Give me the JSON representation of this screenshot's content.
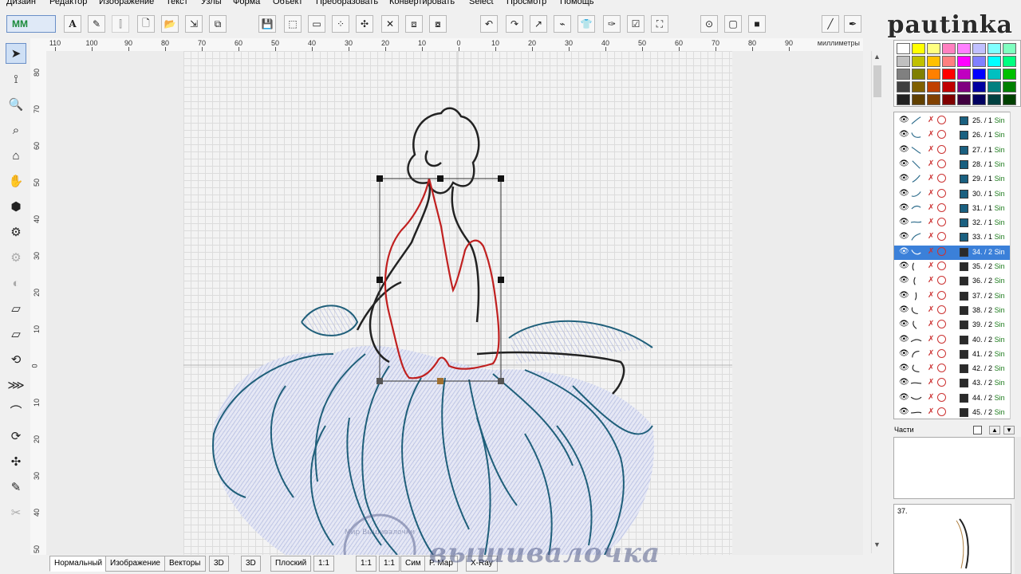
{
  "menu": [
    {
      "label": "Дизайн"
    },
    {
      "label": "Редактор"
    },
    {
      "label": "Изображение"
    },
    {
      "label": "Текст"
    },
    {
      "label": "Узлы"
    },
    {
      "label": "Форма"
    },
    {
      "label": "Объект"
    },
    {
      "label": "Преобразовать"
    },
    {
      "label": "Конвертировать"
    },
    {
      "label": "Select"
    },
    {
      "label": "Просмотр"
    },
    {
      "label": "Помощь"
    }
  ],
  "toolbar": {
    "mode_label": "MM",
    "text_tool": "A",
    "icons": [
      "new",
      "open",
      "import",
      "copy",
      "save",
      "select-rect",
      "rect",
      "node-select",
      "node-add",
      "delete",
      "group",
      "ungroup",
      "undo",
      "redo",
      "curve",
      "stitch",
      "shirt",
      "eyedropper",
      "check",
      "select-all",
      "zoom-fit",
      "display",
      "stop",
      "line",
      "pen"
    ]
  },
  "logo": {
    "text": "pautinka"
  },
  "ruler": {
    "units": "миллиметры",
    "top_labels": [
      "110",
      "100",
      "90",
      "80",
      "70",
      "60",
      "50",
      "40",
      "30",
      "20",
      "10",
      "0",
      "10",
      "20",
      "30",
      "40",
      "50",
      "60",
      "70",
      "80",
      "90"
    ],
    "left_labels": [
      "80",
      "70",
      "60",
      "50",
      "40",
      "30",
      "20",
      "10",
      "0",
      "10",
      "20",
      "30",
      "40",
      "50",
      "60"
    ]
  },
  "tools": [
    "pointer",
    "node-edit",
    "zoom",
    "zoom-1",
    "lasso",
    "pan",
    "shape",
    "stitch-view",
    "settings",
    "fill",
    "run",
    "satin",
    "complex-fill",
    "cross",
    "curve",
    "contour",
    "spray",
    "brush",
    "knife"
  ],
  "tabs": [
    {
      "label": "Нормальный",
      "active": true
    },
    {
      "label": "Изображение"
    },
    {
      "label": "Векторы"
    },
    {
      "label": "3D"
    },
    {
      "label": "3D"
    },
    {
      "label": "Плоский"
    },
    {
      "label": "1:1"
    },
    {
      "label": "1:1"
    },
    {
      "label": "1:1"
    },
    {
      "label": "Сим"
    },
    {
      "label": "Р. Мар"
    },
    {
      "label": "Х-Ray"
    }
  ],
  "watermark": {
    "text": "вышивалочка",
    "stamp_text": "Мир Вышивалочки"
  },
  "palette": {
    "colors": [
      [
        "#ffffff",
        "#ffff00",
        "#ffff80",
        "#ff80c0",
        "#ff80ff",
        "#c0c0ff",
        "#80ffff",
        "#80ffc0"
      ],
      [
        "#c0c0c0",
        "#c0c000",
        "#ffc000",
        "#ff8080",
        "#ff00ff",
        "#8080ff",
        "#00ffff",
        "#00ff80"
      ],
      [
        "#808080",
        "#808000",
        "#ff8000",
        "#ff0000",
        "#c000c0",
        "#0000ff",
        "#00c0c0",
        "#00c000"
      ],
      [
        "#404040",
        "#806000",
        "#c04000",
        "#c00000",
        "#800080",
        "#0000a0",
        "#008080",
        "#008000"
      ],
      [
        "#202020",
        "#604000",
        "#804000",
        "#800000",
        "#400040",
        "#000060",
        "#004040",
        "#004000"
      ]
    ]
  },
  "objects": [
    {
      "num": "25.",
      "info": "/ 1",
      "stype": "Sin",
      "thread": "#1a6080",
      "selected": false
    },
    {
      "num": "26.",
      "info": "/ 1",
      "stype": "Sin",
      "thread": "#1a6080",
      "selected": false
    },
    {
      "num": "27.",
      "info": "/ 1",
      "stype": "Sin",
      "thread": "#1a6080",
      "selected": false
    },
    {
      "num": "28.",
      "info": "/ 1",
      "stype": "Sin",
      "thread": "#1a6080",
      "selected": false
    },
    {
      "num": "29.",
      "info": "/ 1",
      "stype": "Sin",
      "thread": "#1a6080",
      "selected": false
    },
    {
      "num": "30.",
      "info": "/ 1",
      "stype": "Sin",
      "thread": "#1a6080",
      "selected": false
    },
    {
      "num": "31.",
      "info": "/ 1",
      "stype": "Sin",
      "thread": "#1a6080",
      "selected": false
    },
    {
      "num": "32.",
      "info": "/ 1",
      "stype": "Sin",
      "thread": "#1a6080",
      "selected": false
    },
    {
      "num": "33.",
      "info": "/ 1",
      "stype": "Sin",
      "thread": "#1a6080",
      "selected": false
    },
    {
      "num": "34.",
      "info": "/ 2",
      "stype": "Sin",
      "thread": "#2a2a2a",
      "selected": true
    },
    {
      "num": "35.",
      "info": "/ 2",
      "stype": "Sin",
      "thread": "#2a2a2a",
      "selected": false
    },
    {
      "num": "36.",
      "info": "/ 2",
      "stype": "Sin",
      "thread": "#2a2a2a",
      "selected": false
    },
    {
      "num": "37.",
      "info": "/ 2",
      "stype": "Sin",
      "thread": "#2a2a2a",
      "selected": false
    },
    {
      "num": "38.",
      "info": "/ 2",
      "stype": "Sin",
      "thread": "#2a2a2a",
      "selected": false
    },
    {
      "num": "39.",
      "info": "/ 2",
      "stype": "Sin",
      "thread": "#2a2a2a",
      "selected": false
    },
    {
      "num": "40.",
      "info": "/ 2",
      "stype": "Sin",
      "thread": "#2a2a2a",
      "selected": false
    },
    {
      "num": "41.",
      "info": "/ 2",
      "stype": "Sin",
      "thread": "#2a2a2a",
      "selected": false
    },
    {
      "num": "42.",
      "info": "/ 2",
      "stype": "Sin",
      "thread": "#2a2a2a",
      "selected": false
    },
    {
      "num": "43.",
      "info": "/ 2",
      "stype": "Sin",
      "thread": "#2a2a2a",
      "selected": false
    },
    {
      "num": "44.",
      "info": "/ 2",
      "stype": "Sin",
      "thread": "#2a2a2a",
      "selected": false
    },
    {
      "num": "45.",
      "info": "/ 2",
      "stype": "Sin",
      "thread": "#2a2a2a",
      "selected": false
    }
  ],
  "parts": {
    "label": "Части"
  },
  "preview": {
    "num": "37."
  }
}
